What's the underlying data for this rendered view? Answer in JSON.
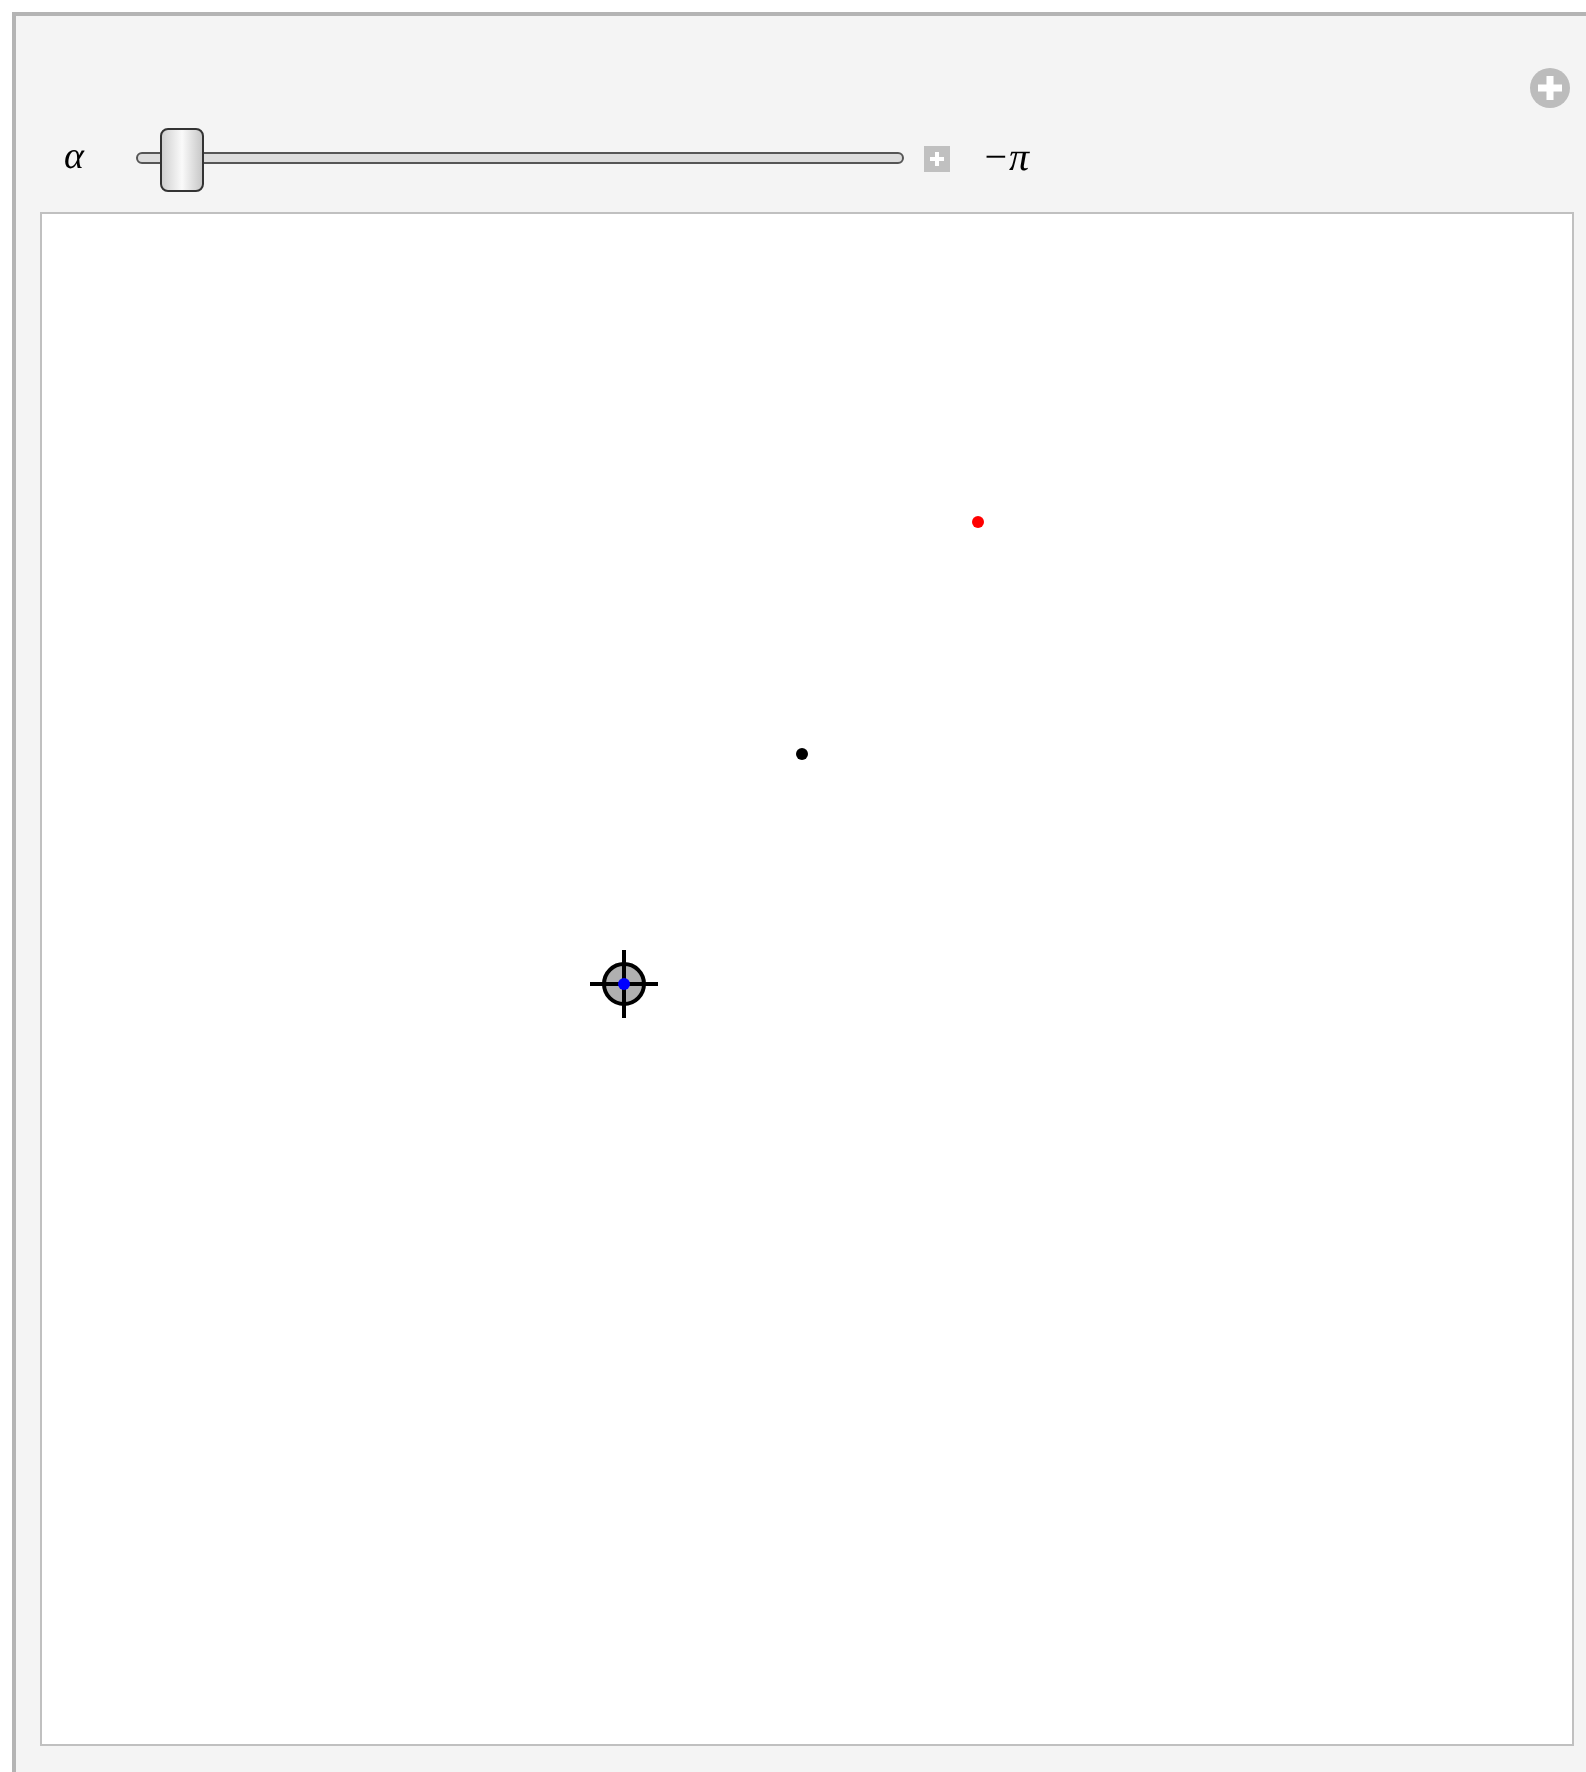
{
  "slider": {
    "label": "α",
    "level": 0,
    "value": "−π"
  }
}
